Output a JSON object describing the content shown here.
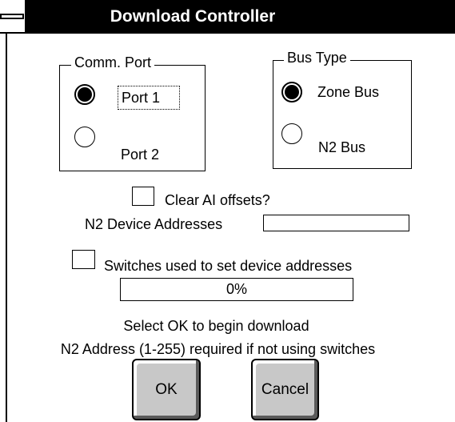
{
  "window": {
    "title": "Download Controller"
  },
  "comm_port": {
    "legend": "Comm. Port",
    "options": [
      {
        "label": "Port 1",
        "selected": true
      },
      {
        "label": "Port 2",
        "selected": false
      }
    ]
  },
  "bus_type": {
    "legend": "Bus Type",
    "options": [
      {
        "label": "Zone Bus",
        "selected": true
      },
      {
        "label": "N2 Bus",
        "selected": false
      }
    ]
  },
  "clear_ai": {
    "label": "Clear AI offsets?",
    "checked": false
  },
  "n2_addresses": {
    "label": "N2 Device Addresses",
    "value": ""
  },
  "switches": {
    "label": "Switches used to set device addresses",
    "checked": false
  },
  "progress": {
    "text": "0%",
    "value": 0
  },
  "messages": {
    "line1": "Select OK to begin download",
    "line2": "N2 Address (1-255) required if not using switches"
  },
  "buttons": {
    "ok": "OK",
    "cancel": "Cancel"
  }
}
